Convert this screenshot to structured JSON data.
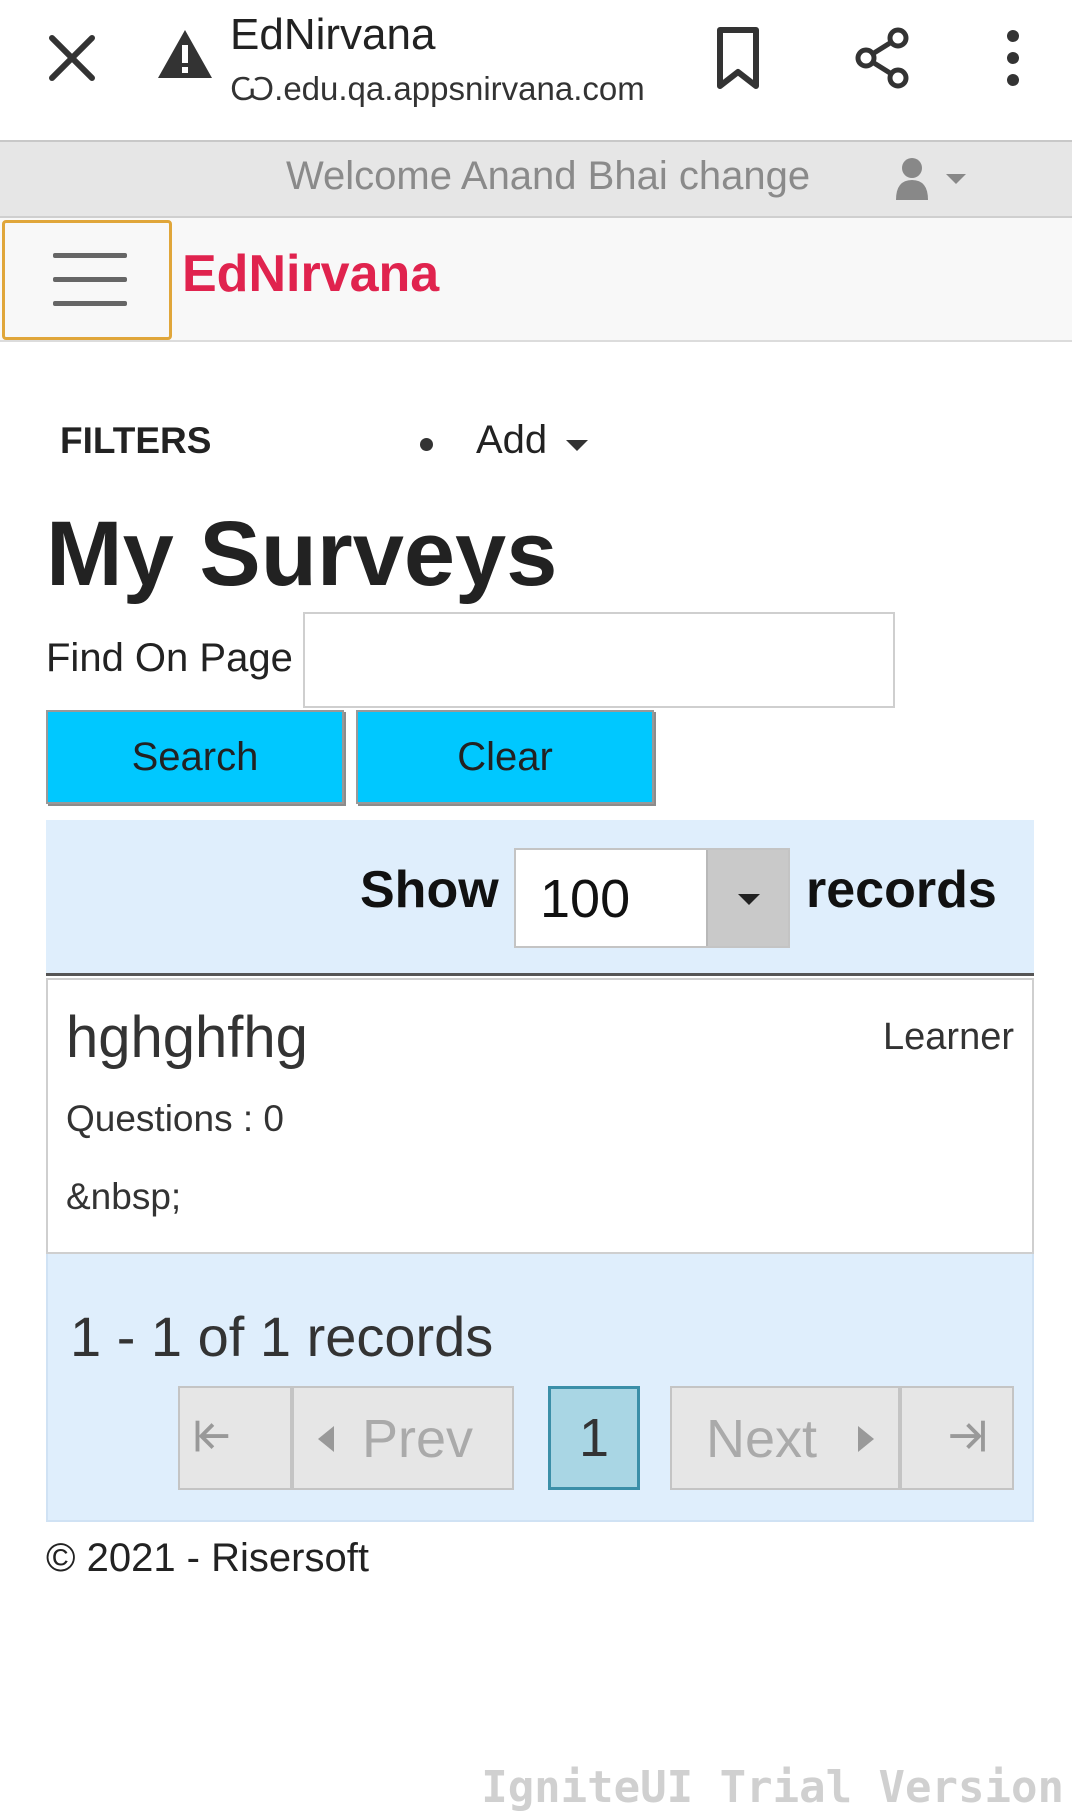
{
  "browser": {
    "title": "EdNirvana",
    "url": "Ѡ.edu.qa.appsnirvana.com",
    "icons": [
      "close-icon",
      "warning-icon",
      "bookmark-icon",
      "share-icon",
      "more-vert-icon"
    ]
  },
  "header": {
    "welcome": "Welcome Anand Bhai change",
    "user_icon": "user-icon"
  },
  "navbar": {
    "brand": "EdNirvana",
    "brand_color": "#e0234e",
    "menu_icon": "hamburger-icon"
  },
  "filters": {
    "label": "FILTERS",
    "add_label": "Add"
  },
  "main": {
    "title": "My Surveys",
    "find_label": "Find On Page",
    "find_value": "",
    "search_label": "Search",
    "clear_label": "Clear",
    "button_color": "#00c8ff"
  },
  "grid": {
    "show_label": "Show",
    "page_size": "100",
    "records_label": "records",
    "rows": [
      {
        "name": "hghghfhg",
        "role": "Learner",
        "questions": "Questions : 0",
        "extra": "&nbsp;"
      }
    ],
    "summary": "1 - 1 of 1 records",
    "pager": {
      "prev_label": "Prev",
      "next_label": "Next",
      "current_page": "1"
    }
  },
  "footer": {
    "copyright": "© 2021 - Risersoft"
  },
  "watermark": "IgniteUI Trial Version"
}
